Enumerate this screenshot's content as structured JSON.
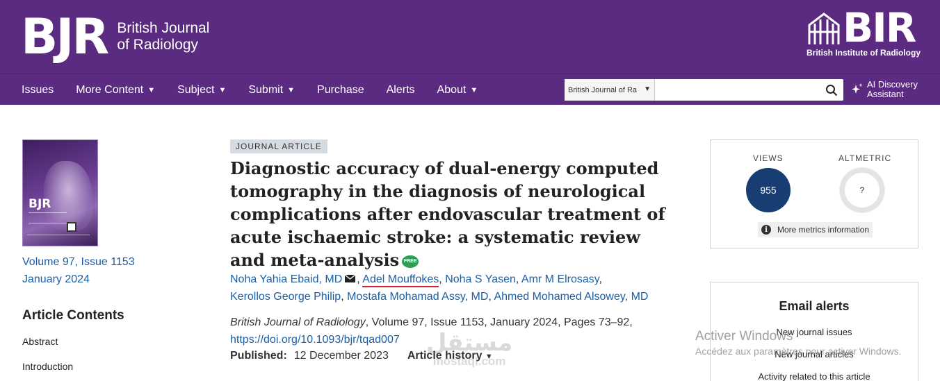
{
  "header": {
    "journal_mark": "BJR",
    "journal_name_line1": "British Journal",
    "journal_name_line2": "of Radiology",
    "publisher_mark": "BIR",
    "publisher_name": "British Institute of Radiology",
    "brand_color": "#5b2b82"
  },
  "nav": {
    "items": [
      {
        "label": "Issues",
        "has_dropdown": false
      },
      {
        "label": "More Content",
        "has_dropdown": true
      },
      {
        "label": "Subject",
        "has_dropdown": true
      },
      {
        "label": "Submit",
        "has_dropdown": true
      },
      {
        "label": "Purchase",
        "has_dropdown": false
      },
      {
        "label": "Alerts",
        "has_dropdown": false
      },
      {
        "label": "About",
        "has_dropdown": true
      }
    ],
    "search_scope": "British Journal of Ra",
    "search_value": "",
    "ai_label": "AI Discovery Assistant"
  },
  "sidebar": {
    "cover_title": "BJR",
    "issue_line1": "Volume 97, Issue 1153",
    "issue_line2": "January 2024",
    "contents_title": "Article Contents",
    "toc": [
      "Abstract",
      "Introduction"
    ]
  },
  "article": {
    "type_badge": "JOURNAL ARTICLE",
    "title": "Diagnostic accuracy of dual-energy computed tomography in the diagnosis of neurological complications after endovascular treatment of acute ischaemic stroke: a systematic review and meta-analysis",
    "free_badge": "FREE",
    "authors": [
      "Noha Yahia Ebaid, MD",
      "Adel Mouffokes",
      "Noha S Yasen",
      "Amr M Elrosasy",
      "Kerollos George Philip",
      "Mostafa Mohamad Assy, MD",
      "Ahmed Mohamed Alsowey, MD"
    ],
    "citation_journal": "British Journal of Radiology",
    "citation_rest": ", Volume 97, Issue 1153, January 2024, Pages 73–92,",
    "doi": "https://doi.org/10.1093/bjr/tqad007",
    "published_label": "Published:",
    "published_date": "12 December 2023",
    "history_label": "Article history"
  },
  "metrics": {
    "views_label": "VIEWS",
    "views_value": "955",
    "altmetric_label": "ALTMETRIC",
    "altmetric_value": "?",
    "more_label": "More metrics information"
  },
  "alerts": {
    "title": "Email alerts",
    "links": [
      "New journal issues",
      "New journal articles",
      "Activity related to this article"
    ]
  },
  "overlays": {
    "windows_line1": "Activer Windows",
    "windows_line2": "Accédez aux paramètres pour activer Windows.",
    "mostaql_arabic": "مستقل",
    "mostaql_latin": "mostaql.com"
  }
}
